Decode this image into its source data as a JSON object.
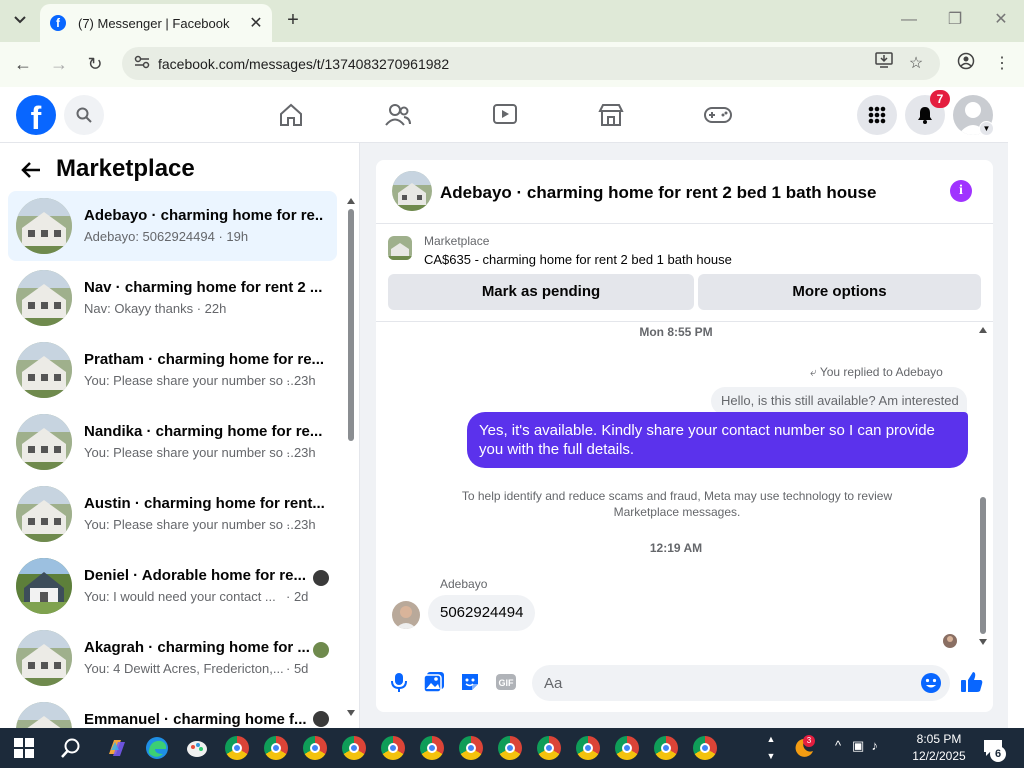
{
  "browser": {
    "tab_title": "(7) Messenger | Facebook",
    "url": "facebook.com/messages/t/1374083270961982",
    "new_tab": "+",
    "tab_close": "✕"
  },
  "fb": {
    "logo": "f",
    "notifications_count": "7"
  },
  "left_panel": {
    "title": "Marketplace",
    "conversations": [
      {
        "title": "Adebayo · charming home for re...",
        "preview": "Adebayo: 5062924494 · 19h",
        "time": "",
        "active": true
      },
      {
        "title": "Nav · charming home for rent 2 ...",
        "preview": "Nav: Okayy thanks · 22h",
        "time": ""
      },
      {
        "title": "Pratham · charming home for re...",
        "preview": "You: Please share your number so ...",
        "time": "· 23h"
      },
      {
        "title": "Nandika · charming home for re...",
        "preview": "You: Please share your number so ...",
        "time": "· 23h"
      },
      {
        "title": "Austin · charming home for rent...",
        "preview": "You: Please share your number so ...",
        "time": "· 23h"
      },
      {
        "title": "Deniel · Adorable home for re...",
        "preview": "You: I would need your contact ...",
        "time": "· 2d"
      },
      {
        "title": "Akagrah · charming home for ...",
        "preview": "You: 4 Dewitt Acres, Fredericton,...",
        "time": "· 5d"
      },
      {
        "title": "Emmanuel · charming home f...",
        "preview": "",
        "time": ""
      }
    ]
  },
  "chat": {
    "title": "Adebayo · charming home for rent 2 bed 1 bath house",
    "marketplace_label": "Marketplace",
    "listing": "CA$635 - charming home for rent 2 bed 1 bath house",
    "mark_pending": "Mark as pending",
    "more_options": "More options",
    "stamp1": "Mon 8:55 PM",
    "replied_to": "You replied to Adebayo",
    "quoted": "Hello, is this still available? Am interested",
    "sent_message": "Yes, it's available. Kindly share your contact number so I can provide you with the full details.",
    "scam_note": "To help identify and reduce scams and fraud, Meta may use technology to review Marketplace messages.",
    "stamp2": "12:19 AM",
    "sender_name": "Adebayo",
    "received_message": "5062924494",
    "composer_placeholder": "Aa",
    "gif_label": "GIF"
  },
  "taskbar": {
    "time": "8:05 PM",
    "date": "12/2/2025",
    "notification_count": "6",
    "weather_badge": "3"
  },
  "colors": {
    "accent": "#0866ff",
    "sent_bubble": "#5b32ec",
    "badge": "#e41e3f",
    "active_row": "#ebf5ff"
  }
}
